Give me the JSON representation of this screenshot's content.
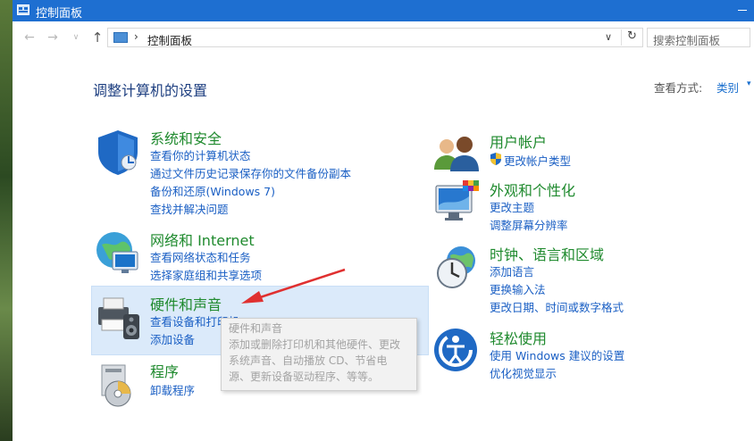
{
  "window": {
    "title": "控制面板",
    "accent": "#1e6fd1"
  },
  "address": {
    "crumb": "控制面板",
    "separator": "›",
    "search_placeholder": "搜索控制面板"
  },
  "nav": {
    "back": "←",
    "forward": "→",
    "dropdown": "∨",
    "up": "↑",
    "refresh": "↻",
    "addr_dropdown": "∨"
  },
  "page": {
    "heading": "调整计算机的设置",
    "view_by_label": "查看方式:",
    "view_by_value": "类别",
    "view_by_arrow": "▾"
  },
  "categories": [
    {
      "id": "system-security",
      "icon": "shield-icon",
      "title": "系统和安全",
      "links": [
        "查看你的计算机状态",
        "通过文件历史记录保存你的文件备份副本",
        "备份和还原(Windows 7)",
        "查找并解决问题"
      ]
    },
    {
      "id": "network-internet",
      "icon": "network-globe-icon",
      "title": "网络和 Internet",
      "links": [
        "查看网络状态和任务",
        "选择家庭组和共享选项"
      ]
    },
    {
      "id": "hardware-sound",
      "icon": "printer-speaker-icon",
      "title": "硬件和声音",
      "links": [
        "查看设备和打印机",
        "添加设备"
      ]
    },
    {
      "id": "programs",
      "icon": "programs-disc-icon",
      "title": "程序",
      "links": [
        "卸载程序"
      ]
    },
    {
      "id": "user-accounts",
      "icon": "users-icon",
      "title": "用户帐户",
      "links": [
        "更改帐户类型"
      ],
      "link_icon": "uac-shield-icon"
    },
    {
      "id": "appearance",
      "icon": "monitor-palette-icon",
      "title": "外观和个性化",
      "links": [
        "更改主题",
        "调整屏幕分辨率"
      ]
    },
    {
      "id": "clock-region",
      "icon": "clock-globe-icon",
      "title": "时钟、语言和区域",
      "links": [
        "添加语言",
        "更换输入法",
        "更改日期、时间或数字格式"
      ]
    },
    {
      "id": "ease-of-access",
      "icon": "ease-of-access-icon",
      "title": "轻松使用",
      "links": [
        "使用 Windows 建议的设置",
        "优化视觉显示"
      ]
    }
  ],
  "tooltip": {
    "title": "硬件和声音",
    "lines": [
      "添加或删除打印机和其他硬件、更改",
      "系统声音、自动播放 CD、节省电",
      "源、更新设备驱动程序、等等。"
    ]
  },
  "colors": {
    "category_title": "#1f8a2e",
    "link": "#1a5fc4",
    "heading": "#1e3f80",
    "annotation_arrow": "#e03030"
  }
}
